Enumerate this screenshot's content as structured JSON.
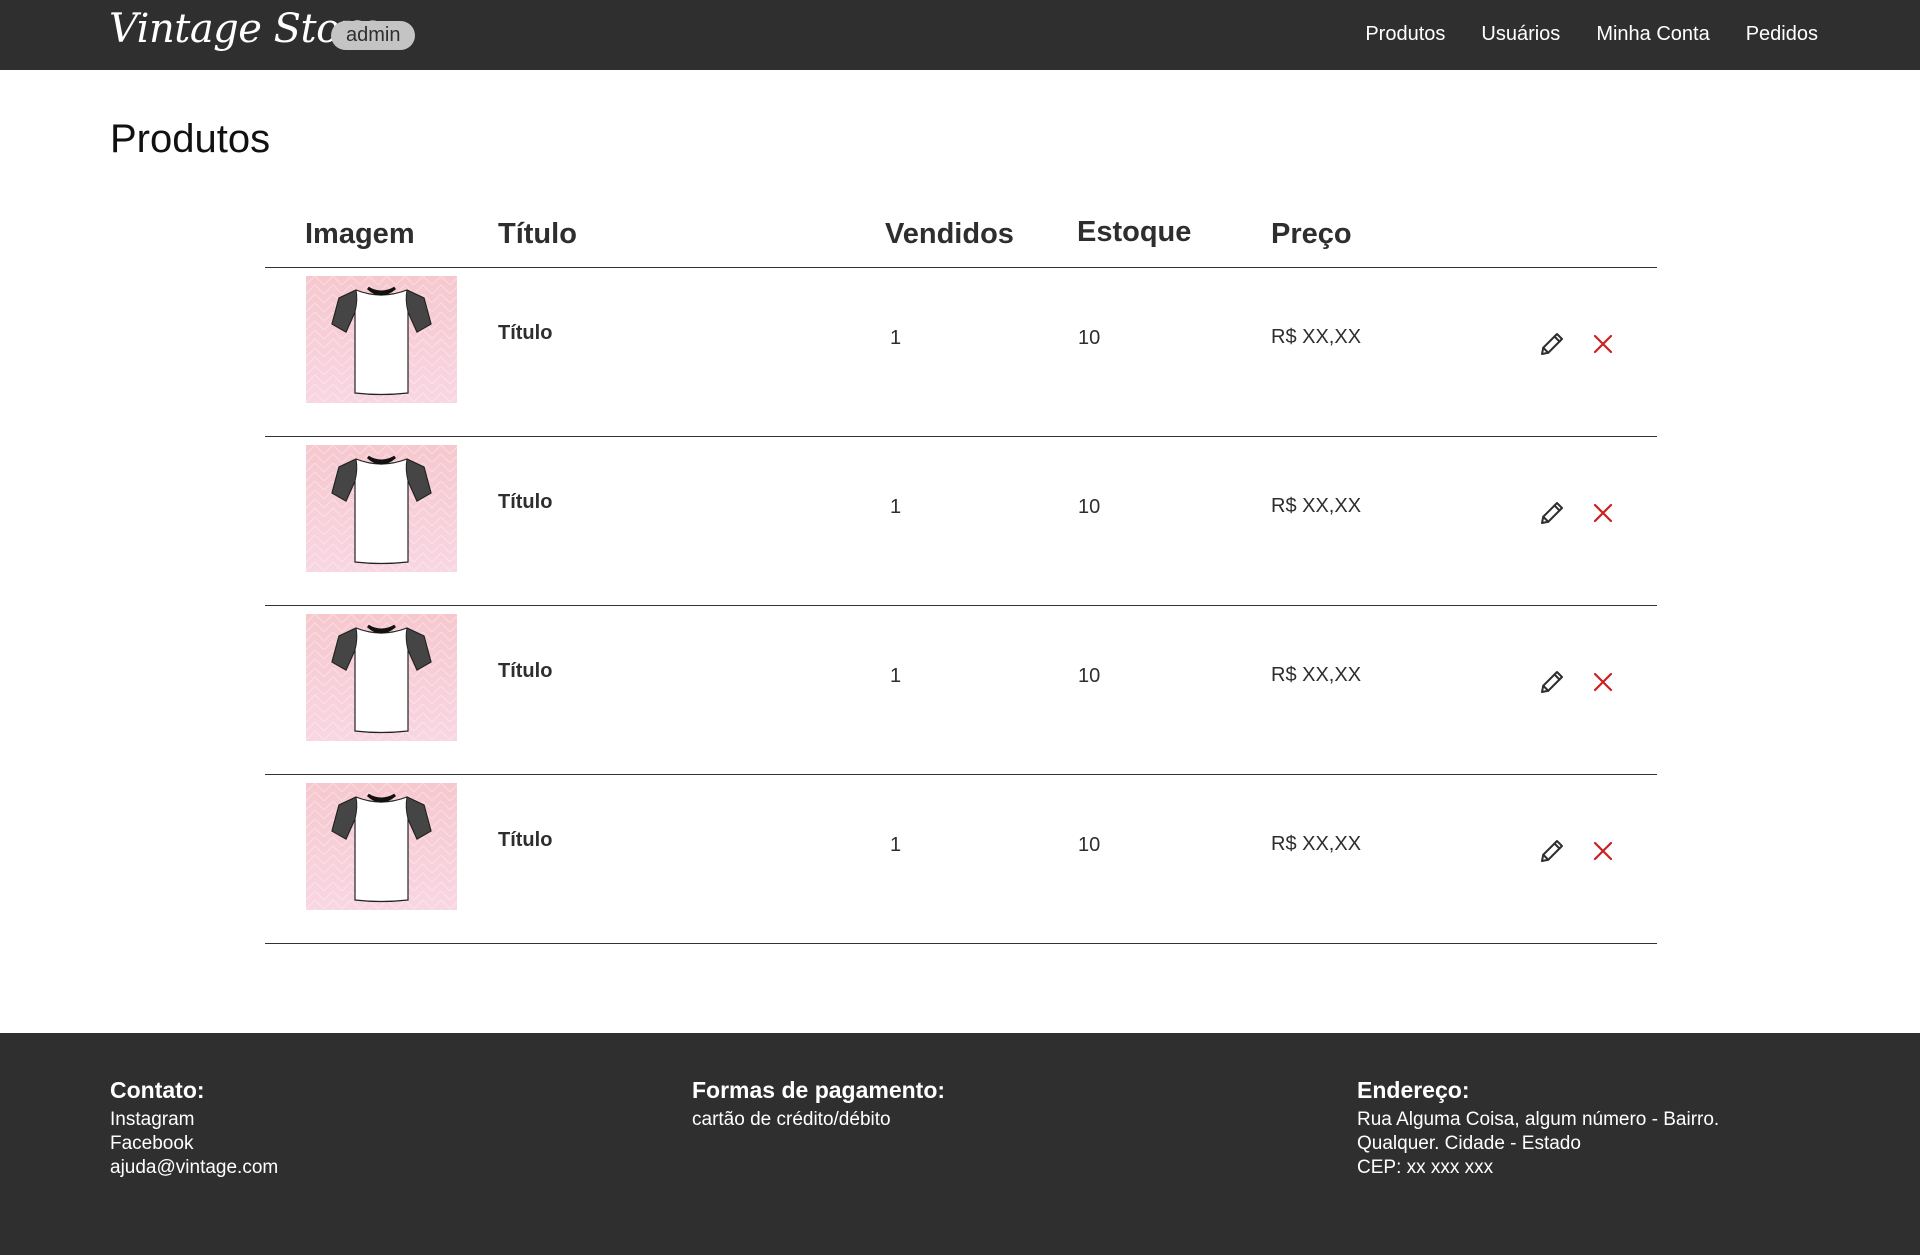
{
  "header": {
    "logo": "Vintage Store",
    "role_badge": "admin",
    "nav": [
      "Produtos",
      "Usuários",
      "Minha Conta",
      "Pedidos"
    ]
  },
  "page": {
    "title": "Produtos"
  },
  "table": {
    "columns": [
      "Imagem",
      "Título",
      "Vendidos",
      "Estoque",
      "Preço"
    ],
    "rows": [
      {
        "title": "Título",
        "sold": "1",
        "stock": "10",
        "price": "R$ XX,XX"
      },
      {
        "title": "Título",
        "sold": "1",
        "stock": "10",
        "price": "R$ XX,XX"
      },
      {
        "title": "Título",
        "sold": "1",
        "stock": "10",
        "price": "R$ XX,XX"
      },
      {
        "title": "Título",
        "sold": "1",
        "stock": "10",
        "price": "R$ XX,XX"
      }
    ],
    "icons": {
      "edit": "pencil-icon",
      "delete": "close-icon"
    }
  },
  "footer": {
    "contact": {
      "heading": "Contato:",
      "lines": [
        "Instagram",
        "Facebook",
        "ajuda@vintage.com"
      ]
    },
    "payment": {
      "heading": "Formas de pagamento:",
      "lines": [
        "cartão de crédito/débito"
      ]
    },
    "address": {
      "heading": "Endereço:",
      "lines": [
        "Rua Alguma Coisa, algum número - Bairro.",
        "Qualquer. Cidade - Estado",
        "CEP: xx xxx xxx"
      ]
    }
  },
  "colors": {
    "header_bg": "#2f2f2f",
    "delete_red": "#cc1f1f",
    "thumb_pink": "#f6c8ce"
  }
}
